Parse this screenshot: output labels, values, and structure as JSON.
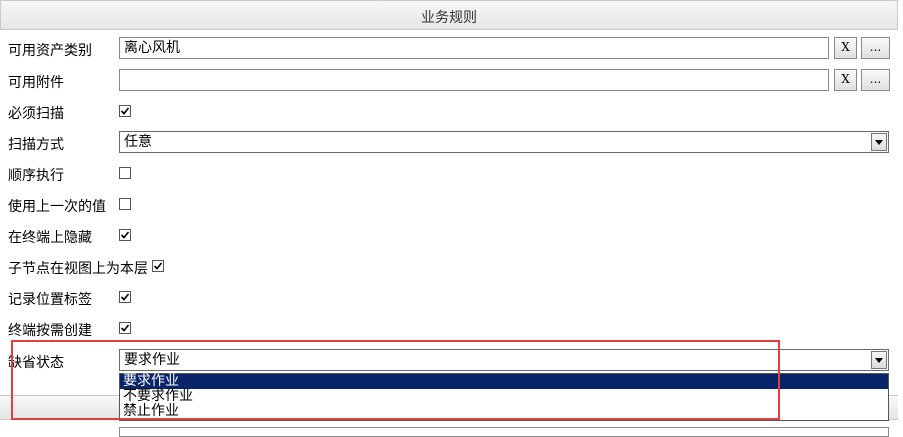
{
  "header": {
    "title": "业务规则"
  },
  "rows": {
    "asset_category": {
      "label": "可用资产类别",
      "value": "离心风机",
      "clear_label": "X",
      "browse_label": "..."
    },
    "attachment": {
      "label": "可用附件",
      "value": "",
      "clear_label": "X",
      "browse_label": "..."
    },
    "must_scan": {
      "label": "必须扫描",
      "checked": true
    },
    "scan_mode": {
      "label": "扫描方式",
      "value": "任意"
    },
    "sequential": {
      "label": "顺序执行",
      "checked": false
    },
    "use_last_value": {
      "label": "使用上一次的值",
      "checked": false
    },
    "hide_on_terminal": {
      "label": "在终端上隐藏",
      "checked": true
    },
    "child_as_layer": {
      "label": "子节点在视图上为本层",
      "checked": true
    },
    "record_location_tag": {
      "label": "记录位置标签",
      "checked": true
    },
    "terminal_create_on_demand": {
      "label": "终端按需创建",
      "checked": true
    },
    "default_state": {
      "label": "缺省状态",
      "value": "要求作业",
      "options": [
        "要求作业",
        "不要求作业",
        "禁止作业"
      ],
      "selected_index": 0
    }
  },
  "colors": {
    "selection": "#0a246a",
    "highlight": "#e04040"
  }
}
